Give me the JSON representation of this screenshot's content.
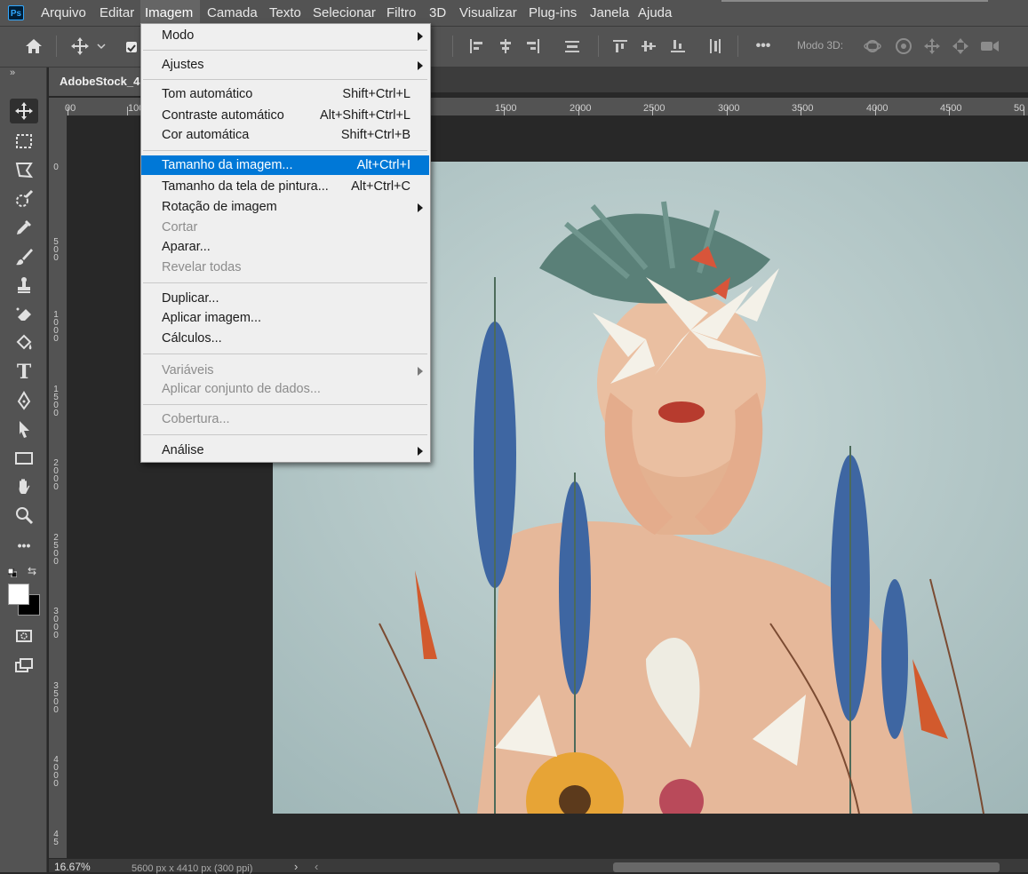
{
  "menubar": {
    "logo": "Ps",
    "items": [
      "Arquivo",
      "Editar",
      "Imagem",
      "Camada",
      "Texto",
      "Selecionar",
      "Filtro",
      "3D",
      "Visualizar",
      "Plug-ins",
      "Janela",
      "Ajuda"
    ],
    "active": "Imagem"
  },
  "options_bar": {
    "mode_3d_label": "Modo 3D:",
    "icons": [
      "home-icon",
      "move-icon",
      "chevron-down-icon",
      "checkbox-icon",
      "align-left-icon",
      "align-center-icon",
      "align-right-icon",
      "distribute-icon",
      "align-top-icon",
      "align-middle-icon",
      "align-bottom-icon",
      "distribute-vertical-icon",
      "more-icon",
      "orbit-3d-icon",
      "roll-3d-icon",
      "pan-3d-icon",
      "slide-3d-icon",
      "scale-3d-icon"
    ]
  },
  "document": {
    "tab_title": "AdobeStock_4",
    "zoom": "16.67%",
    "info": "5600 px x 4410 px (300 ppi)",
    "info_arrow": "›",
    "scroll_left_arrow": "‹"
  },
  "toolbar": {
    "collapse": "»",
    "tools": [
      "move-tool-icon",
      "marquee-tool-icon",
      "lasso-tool-icon",
      "quick-select-tool-icon",
      "eyedropper-tool-icon",
      "brush-tool-icon",
      "clone-stamp-tool-icon",
      "eraser-tool-icon",
      "paint-bucket-tool-icon",
      "type-tool-icon",
      "pen-tool-icon",
      "path-select-tool-icon",
      "rectangle-tool-icon",
      "hand-tool-icon",
      "zoom-tool-icon",
      "more-tools-icon"
    ],
    "foreground_color": "#ffffff",
    "background_color": "#000000"
  },
  "rulers": {
    "horizontal": [
      "00",
      "100",
      "1500",
      "2000",
      "2500",
      "3000",
      "3500",
      "4000",
      "4500",
      "50"
    ],
    "vertical": [
      "0",
      "500",
      "1000",
      "1500",
      "2000",
      "2500",
      "3000",
      "3500",
      "4000",
      "45"
    ]
  },
  "image_menu": {
    "items": [
      {
        "label": "Modo",
        "shortcut": "",
        "submenu": true,
        "enabled": true
      },
      {
        "label": "Ajustes",
        "shortcut": "",
        "submenu": true,
        "enabled": true
      },
      {
        "label": "Tom automático",
        "shortcut": "Shift+Ctrl+L",
        "submenu": false,
        "enabled": true
      },
      {
        "label": "Contraste automático",
        "shortcut": "Alt+Shift+Ctrl+L",
        "submenu": false,
        "enabled": true
      },
      {
        "label": "Cor automática",
        "shortcut": "Shift+Ctrl+B",
        "submenu": false,
        "enabled": true
      },
      {
        "label": "Tamanho da imagem...",
        "shortcut": "Alt+Ctrl+I",
        "submenu": false,
        "enabled": true,
        "highlighted": true
      },
      {
        "label": "Tamanho da tela de pintura...",
        "shortcut": "Alt+Ctrl+C",
        "submenu": false,
        "enabled": true
      },
      {
        "label": "Rotação de imagem",
        "shortcut": "",
        "submenu": true,
        "enabled": true
      },
      {
        "label": "Cortar",
        "shortcut": "",
        "submenu": false,
        "enabled": false
      },
      {
        "label": "Aparar...",
        "shortcut": "",
        "submenu": false,
        "enabled": true
      },
      {
        "label": "Revelar todas",
        "shortcut": "",
        "submenu": false,
        "enabled": false
      },
      {
        "label": "Duplicar...",
        "shortcut": "",
        "submenu": false,
        "enabled": true
      },
      {
        "label": "Aplicar imagem...",
        "shortcut": "",
        "submenu": false,
        "enabled": true
      },
      {
        "label": "Cálculos...",
        "shortcut": "",
        "submenu": false,
        "enabled": true
      },
      {
        "label": "Variáveis",
        "shortcut": "",
        "submenu": true,
        "enabled": false
      },
      {
        "label": "Aplicar conjunto de dados...",
        "shortcut": "",
        "submenu": false,
        "enabled": false
      },
      {
        "label": "Cobertura...",
        "shortcut": "",
        "submenu": false,
        "enabled": false
      },
      {
        "label": "Análise",
        "shortcut": "",
        "submenu": true,
        "enabled": true
      }
    ]
  },
  "colors": {
    "highlight": "#0078d7",
    "ui_panel": "#535353",
    "canvas_bg": "#282828"
  }
}
